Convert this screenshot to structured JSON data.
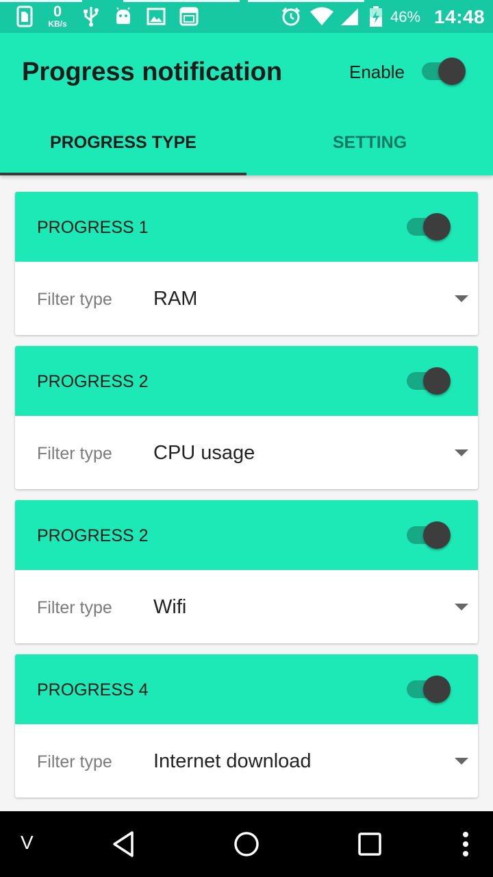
{
  "status_bar": {
    "net_speed_value": "0",
    "net_speed_unit": "KB/s",
    "battery_percent": "46%",
    "time": "14:48",
    "icons": [
      "sim-icon",
      "usb-icon",
      "android-icon",
      "image-icon",
      "window-icon",
      "alarm-icon",
      "wifi-icon",
      "signal-icon",
      "battery-icon"
    ]
  },
  "appbar": {
    "title": "Progress notification",
    "enable_label": "Enable",
    "enabled": true
  },
  "tabs": [
    {
      "label": "PROGRESS TYPE",
      "selected": true
    },
    {
      "label": "SETTING",
      "selected": false
    }
  ],
  "cards": [
    {
      "title": "PROGRESS 1",
      "enabled": true,
      "filter_label": "Filter type",
      "filter_value": "RAM"
    },
    {
      "title": "PROGRESS 2",
      "enabled": true,
      "filter_label": "Filter type",
      "filter_value": "CPU usage"
    },
    {
      "title": "PROGRESS 2",
      "enabled": true,
      "filter_label": "Filter type",
      "filter_value": "Wifi"
    },
    {
      "title": "PROGRESS 4",
      "enabled": true,
      "filter_label": "Filter type",
      "filter_value": "Internet download"
    }
  ],
  "navbar": {
    "left_label": "V",
    "buttons": [
      "back-icon",
      "home-icon",
      "recents-icon",
      "more-icon"
    ]
  },
  "colors": {
    "accent": "#1de9b6",
    "statusbar": "#16c9a2",
    "switch_track": "#17a886",
    "switch_thumb": "#3d3d3d"
  }
}
